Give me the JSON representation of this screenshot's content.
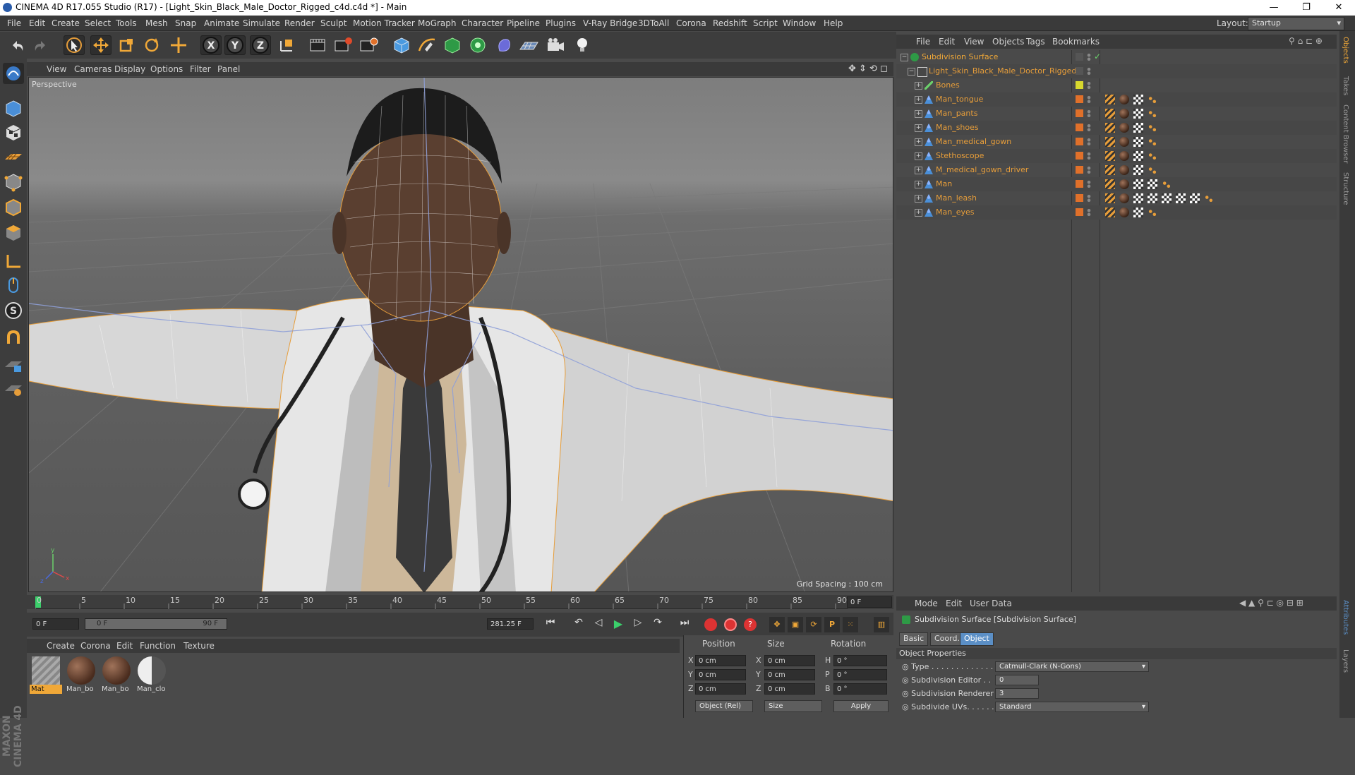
{
  "window": {
    "title": "CINEMA 4D R17.055 Studio (R17) - [Light_Skin_Black_Male_Doctor_Rigged_c4d.c4d *] - Main",
    "controls": [
      "—",
      "❐",
      "✕"
    ]
  },
  "menubar": {
    "items": [
      "File",
      "Edit",
      "Create",
      "Select",
      "Tools",
      "Mesh",
      "Snap",
      "Animate",
      "Simulate",
      "Render",
      "Sculpt",
      "Motion Tracker",
      "MoGraph",
      "Character",
      "Pipeline",
      "Plugins",
      "V-Ray Bridge",
      "3DToAll",
      "Corona",
      "Redshift",
      "Script",
      "Window",
      "Help"
    ],
    "layout_label": "Layout:",
    "layout_value": "Startup"
  },
  "toolbar": {
    "axis_x": "X",
    "axis_y": "Y",
    "axis_z": "Z"
  },
  "viewport": {
    "menu": [
      "View",
      "Cameras",
      "Display",
      "Options",
      "Filter",
      "Panel"
    ],
    "camera_label": "Perspective",
    "grid_spacing": "Grid Spacing : 100 cm"
  },
  "timeline": {
    "ticks": [
      "0",
      "5",
      "10",
      "15",
      "20",
      "25",
      "30",
      "35",
      "40",
      "45",
      "50",
      "55",
      "60",
      "65",
      "70",
      "75",
      "80",
      "85",
      "90"
    ],
    "current_frame": "0 F",
    "start_frame": "0 F",
    "range_start": "0 F",
    "range_end": "90 F",
    "fps_field": "281.25 F"
  },
  "material_manager": {
    "menu": [
      "Create",
      "Corona",
      "Edit",
      "Function",
      "Texture"
    ],
    "materials": [
      {
        "label": "Mat",
        "kind": "stripe",
        "selected": true
      },
      {
        "label": "Man_bo",
        "kind": "brown",
        "selected": false
      },
      {
        "label": "Man_bo",
        "kind": "brown",
        "selected": false
      },
      {
        "label": "Man_clo",
        "kind": "metal",
        "selected": false
      }
    ]
  },
  "coordinates": {
    "headers": {
      "position": "Position",
      "size": "Size",
      "rotation": "Rotation"
    },
    "rows": [
      {
        "axis": "X",
        "pos": "0 cm",
        "size_axis": "X",
        "size": "0 cm",
        "rot_axis": "H",
        "rot": "0 °"
      },
      {
        "axis": "Y",
        "pos": "0 cm",
        "size_axis": "Y",
        "size": "0 cm",
        "rot_axis": "P",
        "rot": "0 °"
      },
      {
        "axis": "Z",
        "pos": "0 cm",
        "size_axis": "Z",
        "size": "0 cm",
        "rot_axis": "B",
        "rot": "0 °"
      }
    ],
    "mode": "Object (Rel)",
    "size_mode": "Size",
    "apply": "Apply"
  },
  "object_manager": {
    "menu": [
      "File",
      "Edit",
      "View",
      "Objects",
      "Tags",
      "Bookmarks"
    ],
    "objects": [
      {
        "name": "Subdivision Surface",
        "indent": 0,
        "color": "#f0a838",
        "tags": 0
      },
      {
        "name": "Light_Skin_Black_Male_Doctor_Rigged",
        "indent": 1,
        "color": "#e69d3a",
        "tags": 0
      },
      {
        "name": "Bones",
        "indent": 2,
        "color": "#e69d3a",
        "tags": 0
      },
      {
        "name": "Man_tongue",
        "indent": 2,
        "color": "#e69d3a",
        "tags": 4
      },
      {
        "name": "Man_pants",
        "indent": 2,
        "color": "#e69d3a",
        "tags": 4
      },
      {
        "name": "Man_shoes",
        "indent": 2,
        "color": "#e69d3a",
        "tags": 4
      },
      {
        "name": "Man_medical_gown",
        "indent": 2,
        "color": "#e69d3a",
        "tags": 4
      },
      {
        "name": "Stethoscope",
        "indent": 2,
        "color": "#e69d3a",
        "tags": 4
      },
      {
        "name": "M_medical_gown_driver",
        "indent": 2,
        "color": "#e69d3a",
        "tags": 4
      },
      {
        "name": "Man",
        "indent": 2,
        "color": "#e69d3a",
        "tags": 5
      },
      {
        "name": "Man_leash",
        "indent": 2,
        "color": "#e69d3a",
        "tags": 8
      },
      {
        "name": "Man_eyes",
        "indent": 2,
        "color": "#e69d3a",
        "tags": 4
      }
    ]
  },
  "attribute_manager": {
    "menu": [
      "Mode",
      "Edit",
      "User Data"
    ],
    "object_title": "Subdivision Surface [Subdivision Surface]",
    "tabs": [
      "Basic",
      "Coord.",
      "Object"
    ],
    "section": "Object Properties",
    "props": [
      {
        "label": "Type . . . . . . . . . . . . .",
        "value": "Catmull-Clark (N-Gons)"
      },
      {
        "label": "Subdivision Editor . .",
        "value": "0"
      },
      {
        "label": "Subdivision Renderer",
        "value": "3"
      },
      {
        "label": "Subdivide UVs. . . . . .",
        "value": "Standard"
      }
    ]
  },
  "right_strip": [
    "Objects",
    "Takes",
    "Content Browser",
    "Structure",
    "Attributes",
    "Layers"
  ],
  "brand": "MAXON CINEMA 4D",
  "colors": {
    "accent": "#f0a838",
    "selection_blue": "#5b8fc6",
    "object_orange": "#e69d3a"
  }
}
